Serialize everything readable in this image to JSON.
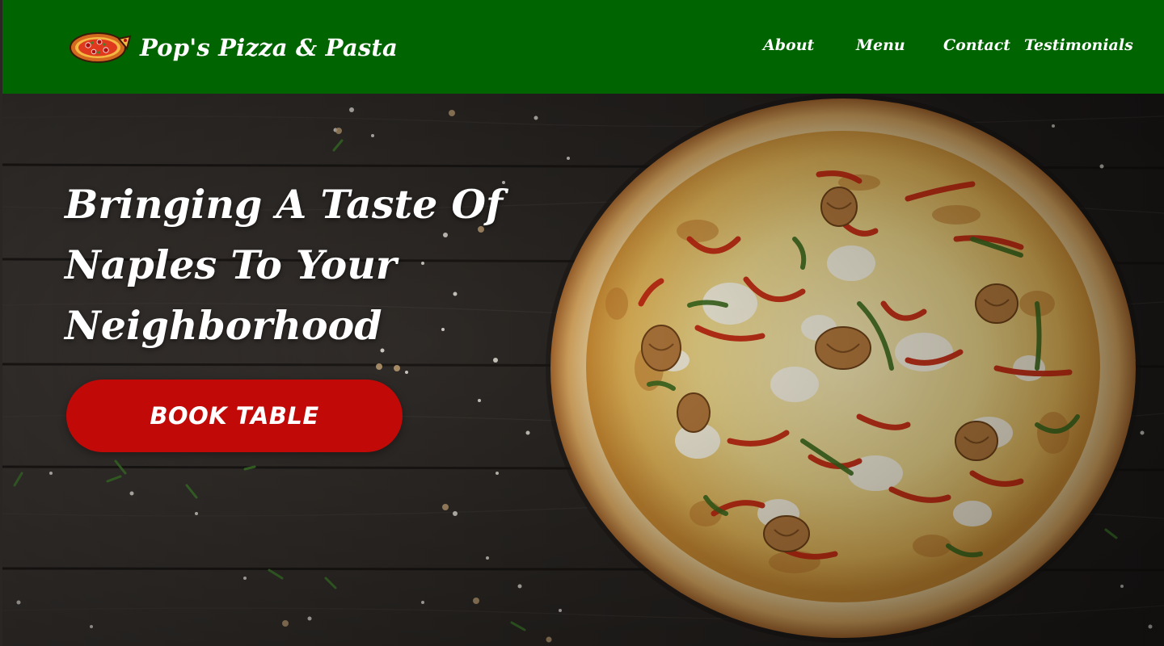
{
  "header": {
    "brand_name": "Pop's Pizza & Pasta",
    "logo_icon": "pizza-icon",
    "background_color": "#006400"
  },
  "nav": {
    "items": [
      {
        "label": "About"
      },
      {
        "label": "Menu"
      },
      {
        "label": "Contact"
      },
      {
        "label": "Testimonials"
      }
    ]
  },
  "hero": {
    "headline": "Bringing A Taste Of Naples To Your Neighborhood",
    "cta_label": "BOOK TABLE",
    "cta_color": "#c10a08",
    "background_image": "pizza-on-wooden-table-photo"
  }
}
